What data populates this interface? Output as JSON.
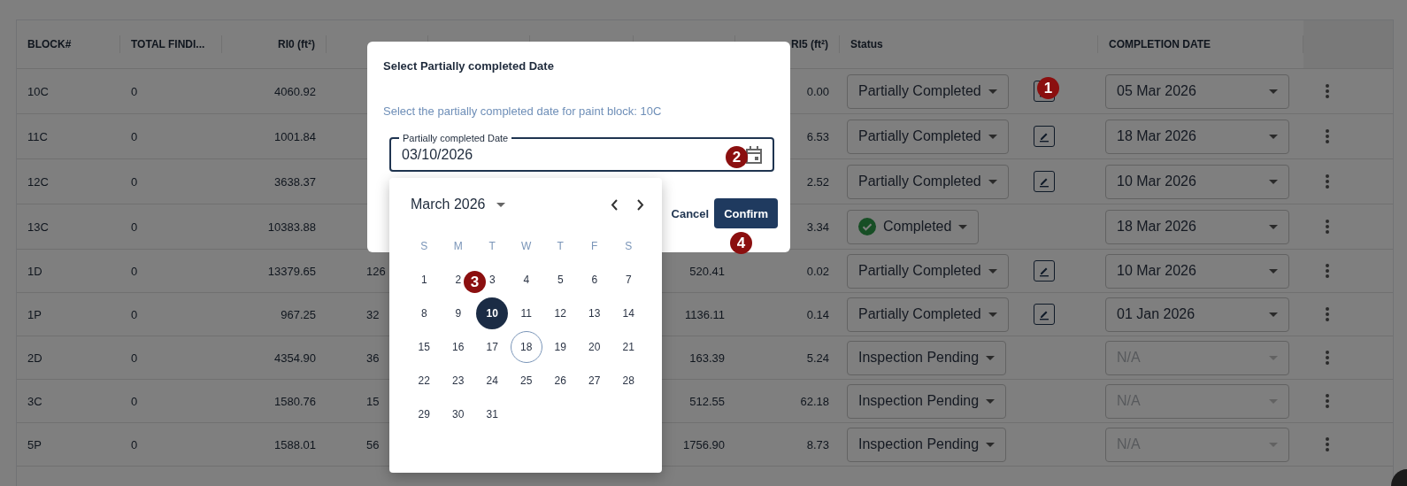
{
  "table": {
    "columns": [
      "BLOCK#",
      "TOTAL FINDI...",
      "RI0 (ft²)",
      "RI5 (ft²)",
      "Status",
      "COMPLETION DATE"
    ],
    "rows": [
      {
        "block": "10C",
        "total_findings": "0",
        "ri0": "4060.92",
        "ri5": "0.00",
        "status": {
          "label": "Partially Completed",
          "kind": "partial"
        },
        "editable": true,
        "completion": {
          "value": "05 Mar 2026",
          "disabled": false
        }
      },
      {
        "block": "11C",
        "total_findings": "0",
        "ri0": "1001.84",
        "ri5": "6.53",
        "status": {
          "label": "Partially Completed",
          "kind": "partial"
        },
        "editable": true,
        "completion": {
          "value": "18 Mar 2026",
          "disabled": false
        }
      },
      {
        "block": "12C",
        "total_findings": "0",
        "ri0": "3638.37",
        "ri5": "2.52",
        "status": {
          "label": "Partially Completed",
          "kind": "partial"
        },
        "editable": true,
        "completion": {
          "value": "10 Mar 2026",
          "disabled": false
        }
      },
      {
        "block": "13C",
        "total_findings": "0",
        "ri0": "10383.88",
        "ri5": "3.34",
        "status": {
          "label": "Completed",
          "kind": "completed"
        },
        "editable": false,
        "completion": {
          "value": "18 Mar 2026",
          "disabled": false
        }
      },
      {
        "block": "1D",
        "total_findings": "0",
        "ri0": "13379.65",
        "ri1": "126",
        "ri4": "520.41",
        "ri5": "0.02",
        "status": {
          "label": "Partially Completed",
          "kind": "partial"
        },
        "editable": true,
        "completion": {
          "value": "10 Mar 2026",
          "disabled": false
        }
      },
      {
        "block": "1P",
        "total_findings": "0",
        "ri0": "967.25",
        "ri1": "32",
        "ri4": "1136.11",
        "ri5": "0.14",
        "status": {
          "label": "Partially Completed",
          "kind": "partial"
        },
        "editable": true,
        "completion": {
          "value": "01 Jan 2026",
          "disabled": false
        }
      },
      {
        "block": "2D",
        "total_findings": "0",
        "ri0": "4354.90",
        "ri1": "36",
        "ri4": "163.39",
        "ri5": "5.24",
        "status": {
          "label": "Inspection Pending",
          "kind": "pending"
        },
        "editable": false,
        "completion": {
          "value": "N/A",
          "disabled": true
        }
      },
      {
        "block": "3C",
        "total_findings": "0",
        "ri0": "1580.76",
        "ri1": "15",
        "ri4": "512.55",
        "ri5": "62.18",
        "status": {
          "label": "Inspection Pending",
          "kind": "pending"
        },
        "editable": false,
        "completion": {
          "value": "N/A",
          "disabled": true
        }
      },
      {
        "block": "5P",
        "total_findings": "0",
        "ri0": "1588.01",
        "ri1": "56",
        "ri4": "1756.90",
        "ri5": "8.73",
        "status": {
          "label": "Inspection Pending",
          "kind": "pending"
        },
        "editable": false,
        "completion": {
          "value": "N/A",
          "disabled": true
        }
      }
    ]
  },
  "dialog": {
    "title": "Select Partially completed Date",
    "description": "Select the partially completed date for paint block: 10C",
    "field": {
      "label": "Partially completed Date",
      "value": "03/10/2026"
    },
    "buttons": [
      {
        "label": "Cancel",
        "kind": "text"
      },
      {
        "label": "Confirm",
        "kind": "primary"
      }
    ]
  },
  "calendar": {
    "month": "March 2026",
    "weekdays": [
      "S",
      "M",
      "T",
      "W",
      "T",
      "F",
      "S"
    ],
    "days": [
      {
        "label": "1",
        "selected": false,
        "today": false
      },
      {
        "label": "2",
        "selected": false,
        "today": false
      },
      {
        "label": "3",
        "selected": false,
        "today": false
      },
      {
        "label": "4",
        "selected": false,
        "today": false
      },
      {
        "label": "5",
        "selected": false,
        "today": false
      },
      {
        "label": "6",
        "selected": false,
        "today": false
      },
      {
        "label": "7",
        "selected": false,
        "today": false
      },
      {
        "label": "8",
        "selected": false,
        "today": false
      },
      {
        "label": "9",
        "selected": false,
        "today": false
      },
      {
        "label": "10",
        "selected": true,
        "today": false
      },
      {
        "label": "11",
        "selected": false,
        "today": false
      },
      {
        "label": "12",
        "selected": false,
        "today": false
      },
      {
        "label": "13",
        "selected": false,
        "today": false
      },
      {
        "label": "14",
        "selected": false,
        "today": false
      },
      {
        "label": "15",
        "selected": false,
        "today": false
      },
      {
        "label": "16",
        "selected": false,
        "today": false
      },
      {
        "label": "17",
        "selected": false,
        "today": false
      },
      {
        "label": "18",
        "selected": false,
        "today": true
      },
      {
        "label": "19",
        "selected": false,
        "today": false
      },
      {
        "label": "20",
        "selected": false,
        "today": false
      },
      {
        "label": "21",
        "selected": false,
        "today": false
      },
      {
        "label": "22",
        "selected": false,
        "today": false
      },
      {
        "label": "23",
        "selected": false,
        "today": false
      },
      {
        "label": "24",
        "selected": false,
        "today": false
      },
      {
        "label": "25",
        "selected": false,
        "today": false
      },
      {
        "label": "26",
        "selected": false,
        "today": false
      },
      {
        "label": "27",
        "selected": false,
        "today": false
      },
      {
        "label": "28",
        "selected": false,
        "today": false
      },
      {
        "label": "29",
        "selected": false,
        "today": false
      },
      {
        "label": "30",
        "selected": false,
        "today": false
      },
      {
        "label": "31",
        "selected": false,
        "today": false
      }
    ]
  },
  "markers": [
    "1",
    "2",
    "3",
    "4"
  ]
}
